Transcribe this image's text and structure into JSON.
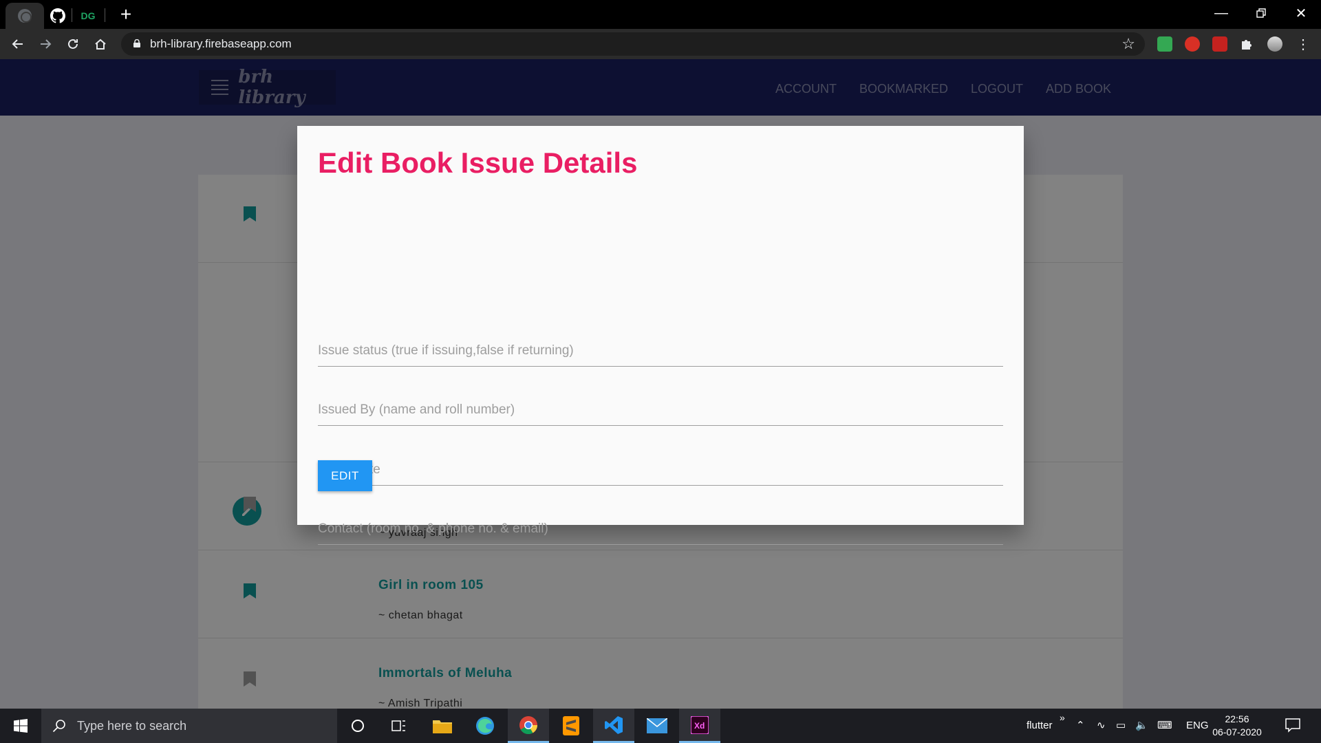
{
  "browser": {
    "tab_dg_label": "DG",
    "url": "brh-library.firebaseapp.com"
  },
  "app": {
    "brand": "brh library",
    "nav": [
      "ACCOUNT",
      "BOOKMARKED",
      "LOGOUT",
      "ADD BOOK"
    ]
  },
  "books": [
    {
      "title": "",
      "author": "~ yuvraaj singh"
    },
    {
      "title": "Girl in room 105",
      "author": "~ chetan bhagat"
    },
    {
      "title": "Immortals of Meluha",
      "author": "~ Amish Tripathi"
    }
  ],
  "modal": {
    "title": "Edit Book Issue Details",
    "fields": [
      {
        "placeholder": "Issue status (true if issuing,false if returning)",
        "value": ""
      },
      {
        "placeholder": "Issued By (name and roll number)",
        "value": ""
      },
      {
        "placeholder": "Issue Date",
        "value": ""
      },
      {
        "placeholder": "Contact (room no. & phone no. & email)",
        "value": ""
      }
    ],
    "submit_label": "EDIT"
  },
  "taskbar": {
    "search_placeholder": "Type here to search",
    "flutter_label": "flutter",
    "language": "ENG",
    "time": "22:56",
    "date": "06-07-2020"
  },
  "colors": {
    "appbar": "#1a2060",
    "title_accent": "#e91e63",
    "book_title": "#139a9a",
    "button": "#2196f3"
  }
}
